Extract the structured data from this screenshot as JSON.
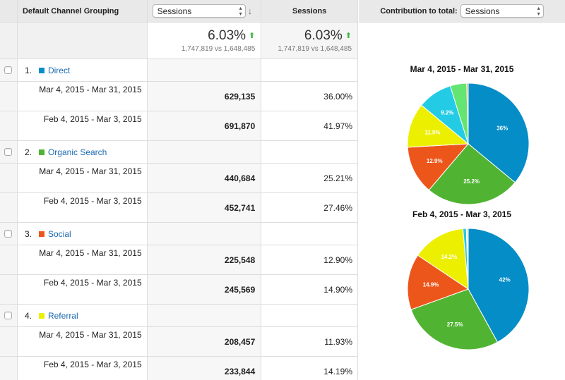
{
  "table": {
    "header": {
      "dimension_label": "Default Channel Grouping",
      "metric_select": "Sessions",
      "sort_icon": "arrow-down-icon",
      "pct_label": "Sessions"
    },
    "summary": {
      "value_change": "6.03%",
      "value_compare": "1,747,819 vs 1,648,485",
      "pct_change": "6.03%",
      "pct_compare": "1,747,819 vs 1,648,485",
      "trend_icon": "arrow-up-icon"
    },
    "groups": [
      {
        "index": "1.",
        "name": "Direct",
        "color": "#058dc7",
        "rows": [
          {
            "range": "Mar 4, 2015 - Mar 31, 2015",
            "sessions": "629,135",
            "pct": "36.00%"
          },
          {
            "range": "Feb 4, 2015 - Mar 3, 2015",
            "sessions": "691,870",
            "pct": "41.97%"
          }
        ]
      },
      {
        "index": "2.",
        "name": "Organic Search",
        "color": "#50b432",
        "rows": [
          {
            "range": "Mar 4, 2015 - Mar 31, 2015",
            "sessions": "440,684",
            "pct": "25.21%"
          },
          {
            "range": "Feb 4, 2015 - Mar 3, 2015",
            "sessions": "452,741",
            "pct": "27.46%"
          }
        ]
      },
      {
        "index": "3.",
        "name": "Social",
        "color": "#ed561b",
        "rows": [
          {
            "range": "Mar 4, 2015 - Mar 31, 2015",
            "sessions": "225,548",
            "pct": "12.90%"
          },
          {
            "range": "Feb 4, 2015 - Mar 3, 2015",
            "sessions": "245,569",
            "pct": "14.90%"
          }
        ]
      },
      {
        "index": "4.",
        "name": "Referral",
        "color": "#edef00",
        "rows": [
          {
            "range": "Mar 4, 2015 - Mar 31, 2015",
            "sessions": "208,457",
            "pct": "11.93%"
          },
          {
            "range": "Feb 4, 2015 - Mar 3, 2015",
            "sessions": "233,844",
            "pct": "14.19%"
          }
        ]
      }
    ]
  },
  "contribution": {
    "label": "Contribution to total:",
    "select": "Sessions"
  },
  "chart_data": [
    {
      "type": "pie",
      "title": "Mar 4, 2015 - Mar 31, 2015",
      "slices": [
        {
          "value": 36.0,
          "label": "36%",
          "color": "#058dc7"
        },
        {
          "value": 25.2,
          "label": "25.2%",
          "color": "#50b432"
        },
        {
          "value": 12.9,
          "label": "12.9%",
          "color": "#ed561b"
        },
        {
          "value": 11.9,
          "label": "11.9%",
          "color": "#edef00"
        },
        {
          "value": 9.2,
          "label": "9.2%",
          "color": "#24cbe5"
        },
        {
          "value": 4.4,
          "label": "",
          "color": "#64e572"
        },
        {
          "value": 0.4,
          "label": "",
          "color": "#ff9655"
        }
      ]
    },
    {
      "type": "pie",
      "title": "Feb 4, 2015 - Mar 3, 2015",
      "slices": [
        {
          "value": 42.0,
          "label": "42%",
          "color": "#058dc7"
        },
        {
          "value": 27.5,
          "label": "27.5%",
          "color": "#50b432"
        },
        {
          "value": 14.9,
          "label": "14.9%",
          "color": "#ed561b"
        },
        {
          "value": 14.2,
          "label": "14.2%",
          "color": "#edef00"
        },
        {
          "value": 0.9,
          "label": "",
          "color": "#24cbe5"
        },
        {
          "value": 0.2,
          "label": "",
          "color": "#64e572"
        },
        {
          "value": 0.3,
          "label": "",
          "color": "#ff9655"
        }
      ]
    }
  ]
}
